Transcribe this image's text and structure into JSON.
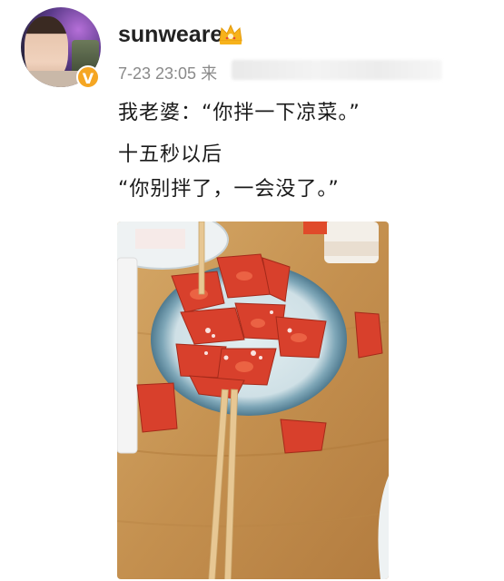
{
  "user": {
    "name": "sunweare",
    "verified_mark": "V",
    "avatar_icon": "user-avatar-photo",
    "crown_icon": "crown-emoji"
  },
  "meta": {
    "time": "7-23 23:05",
    "source_char": "来"
  },
  "post": {
    "lines": [
      "我老婆：“你拌一下凉菜。”",
      "十五秒以后",
      "“你别拌了，一会没了。”"
    ]
  },
  "photo": {
    "subject": "plate-of-sliced-tomatoes-with-sugar",
    "colors": {
      "table": "#c99a5e",
      "plate": "#8fb3c4",
      "tomato": "#d8402c"
    }
  }
}
